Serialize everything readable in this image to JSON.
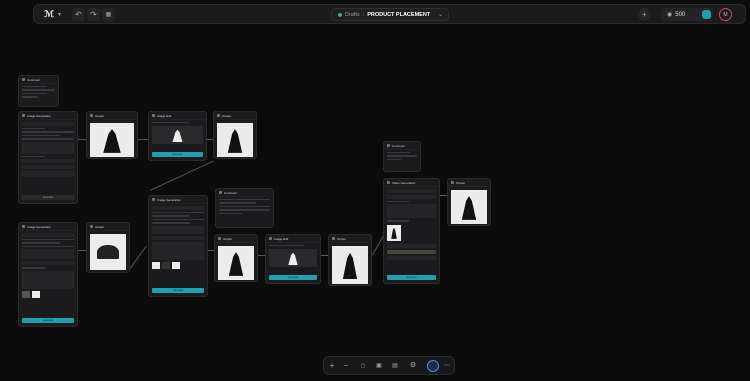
{
  "topbar": {
    "breadcrumb_root": "Drafts",
    "breadcrumb_sep": "/",
    "project_title": "PRODUCT PLACEMENT",
    "credits": "500",
    "avatar_initial": "M",
    "undo_icon": "undo-icon",
    "redo_icon": "redo-icon"
  },
  "nodes": {
    "comment1": {
      "title": "Comment"
    },
    "comment2": {
      "title": "Comment"
    },
    "comment3": {
      "title": "Comment"
    },
    "imgGen1": {
      "title": "Image Generation",
      "button": "Generate"
    },
    "imgGen2": {
      "title": "Image Generation",
      "button": "Generate"
    },
    "imgGen3": {
      "title": "Image Generation",
      "button": "Generate"
    },
    "imgEdit1": {
      "title": "Image Edit",
      "button": "Generate"
    },
    "imgEdit2": {
      "title": "Image Edit",
      "button": "Generate"
    },
    "videoGen": {
      "title": "Video Generation",
      "button": "Generate"
    },
    "output1": {
      "title": "Output"
    },
    "output2": {
      "title": "Output"
    },
    "output3": {
      "title": "Output"
    },
    "output4": {
      "title": "Output"
    },
    "output5": {
      "title": "Output"
    },
    "output6": {
      "title": "Output"
    }
  },
  "zoombar": {
    "zoom_in_icon": "plus-icon",
    "zoom_out_icon": "minus-icon"
  }
}
